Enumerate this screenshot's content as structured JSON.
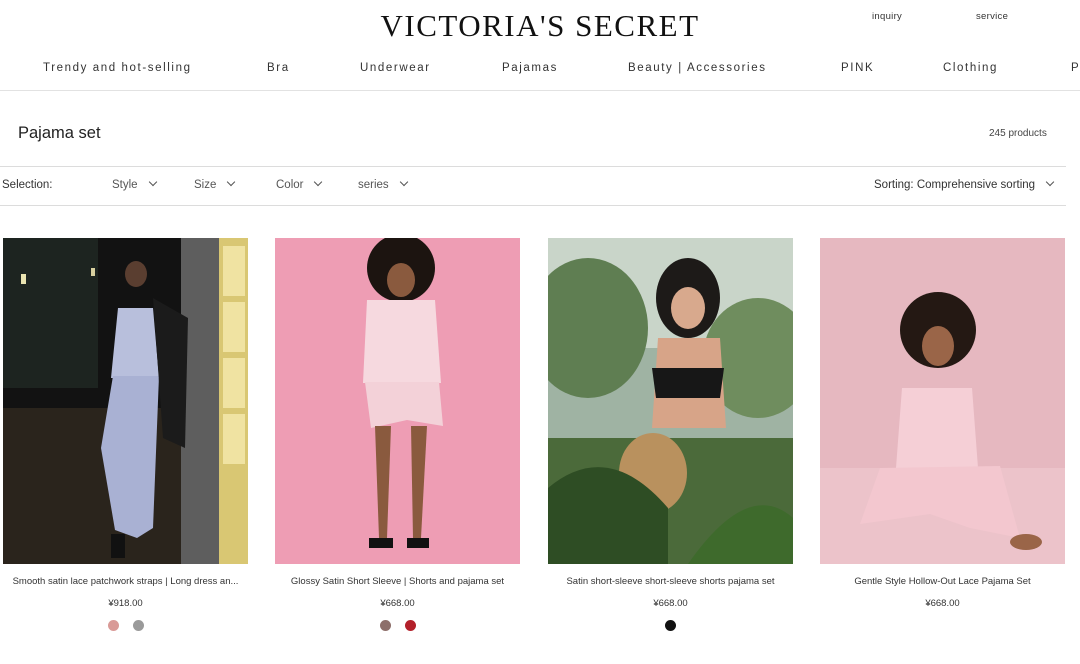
{
  "brand": {
    "logo_text": "VICTORIA'S SECRET"
  },
  "utility": {
    "inquiry": "inquiry",
    "service": "service"
  },
  "nav": {
    "items": [
      {
        "label": "Trendy and hot-selling"
      },
      {
        "label": "Bra"
      },
      {
        "label": "Underwear"
      },
      {
        "label": "Pajamas"
      },
      {
        "label": "Beauty | Accessories"
      },
      {
        "label": "PINK"
      },
      {
        "label": "Clothing"
      },
      {
        "label": "P"
      }
    ]
  },
  "page": {
    "title": "Pajama set",
    "count": "245 products"
  },
  "filters": {
    "selection_label": "Selection:",
    "items": [
      {
        "label": "Style"
      },
      {
        "label": "Size"
      },
      {
        "label": "Color"
      },
      {
        "label": "series"
      }
    ],
    "sort_label": "Sorting: Comprehensive sorting"
  },
  "products": [
    {
      "name": "Smooth satin lace patchwork straps | Long dress an...",
      "price": "¥918.00",
      "swatches": [
        "#d99a97",
        "#9a9a9a"
      ]
    },
    {
      "name": "Glossy Satin Short Sleeve | Shorts and pajama set",
      "price": "¥668.00",
      "swatches": [
        "#8d6f6a",
        "#b3202a"
      ]
    },
    {
      "name": "Satin short-sleeve short-sleeve shorts pajama set",
      "price": "¥668.00",
      "swatches": [
        "#111111"
      ]
    },
    {
      "name": "Gentle Style Hollow-Out Lace Pajama Set",
      "price": "¥668.00",
      "swatches": []
    }
  ],
  "colors": {
    "accent": "#111111",
    "rule": "#dcdcdc"
  }
}
